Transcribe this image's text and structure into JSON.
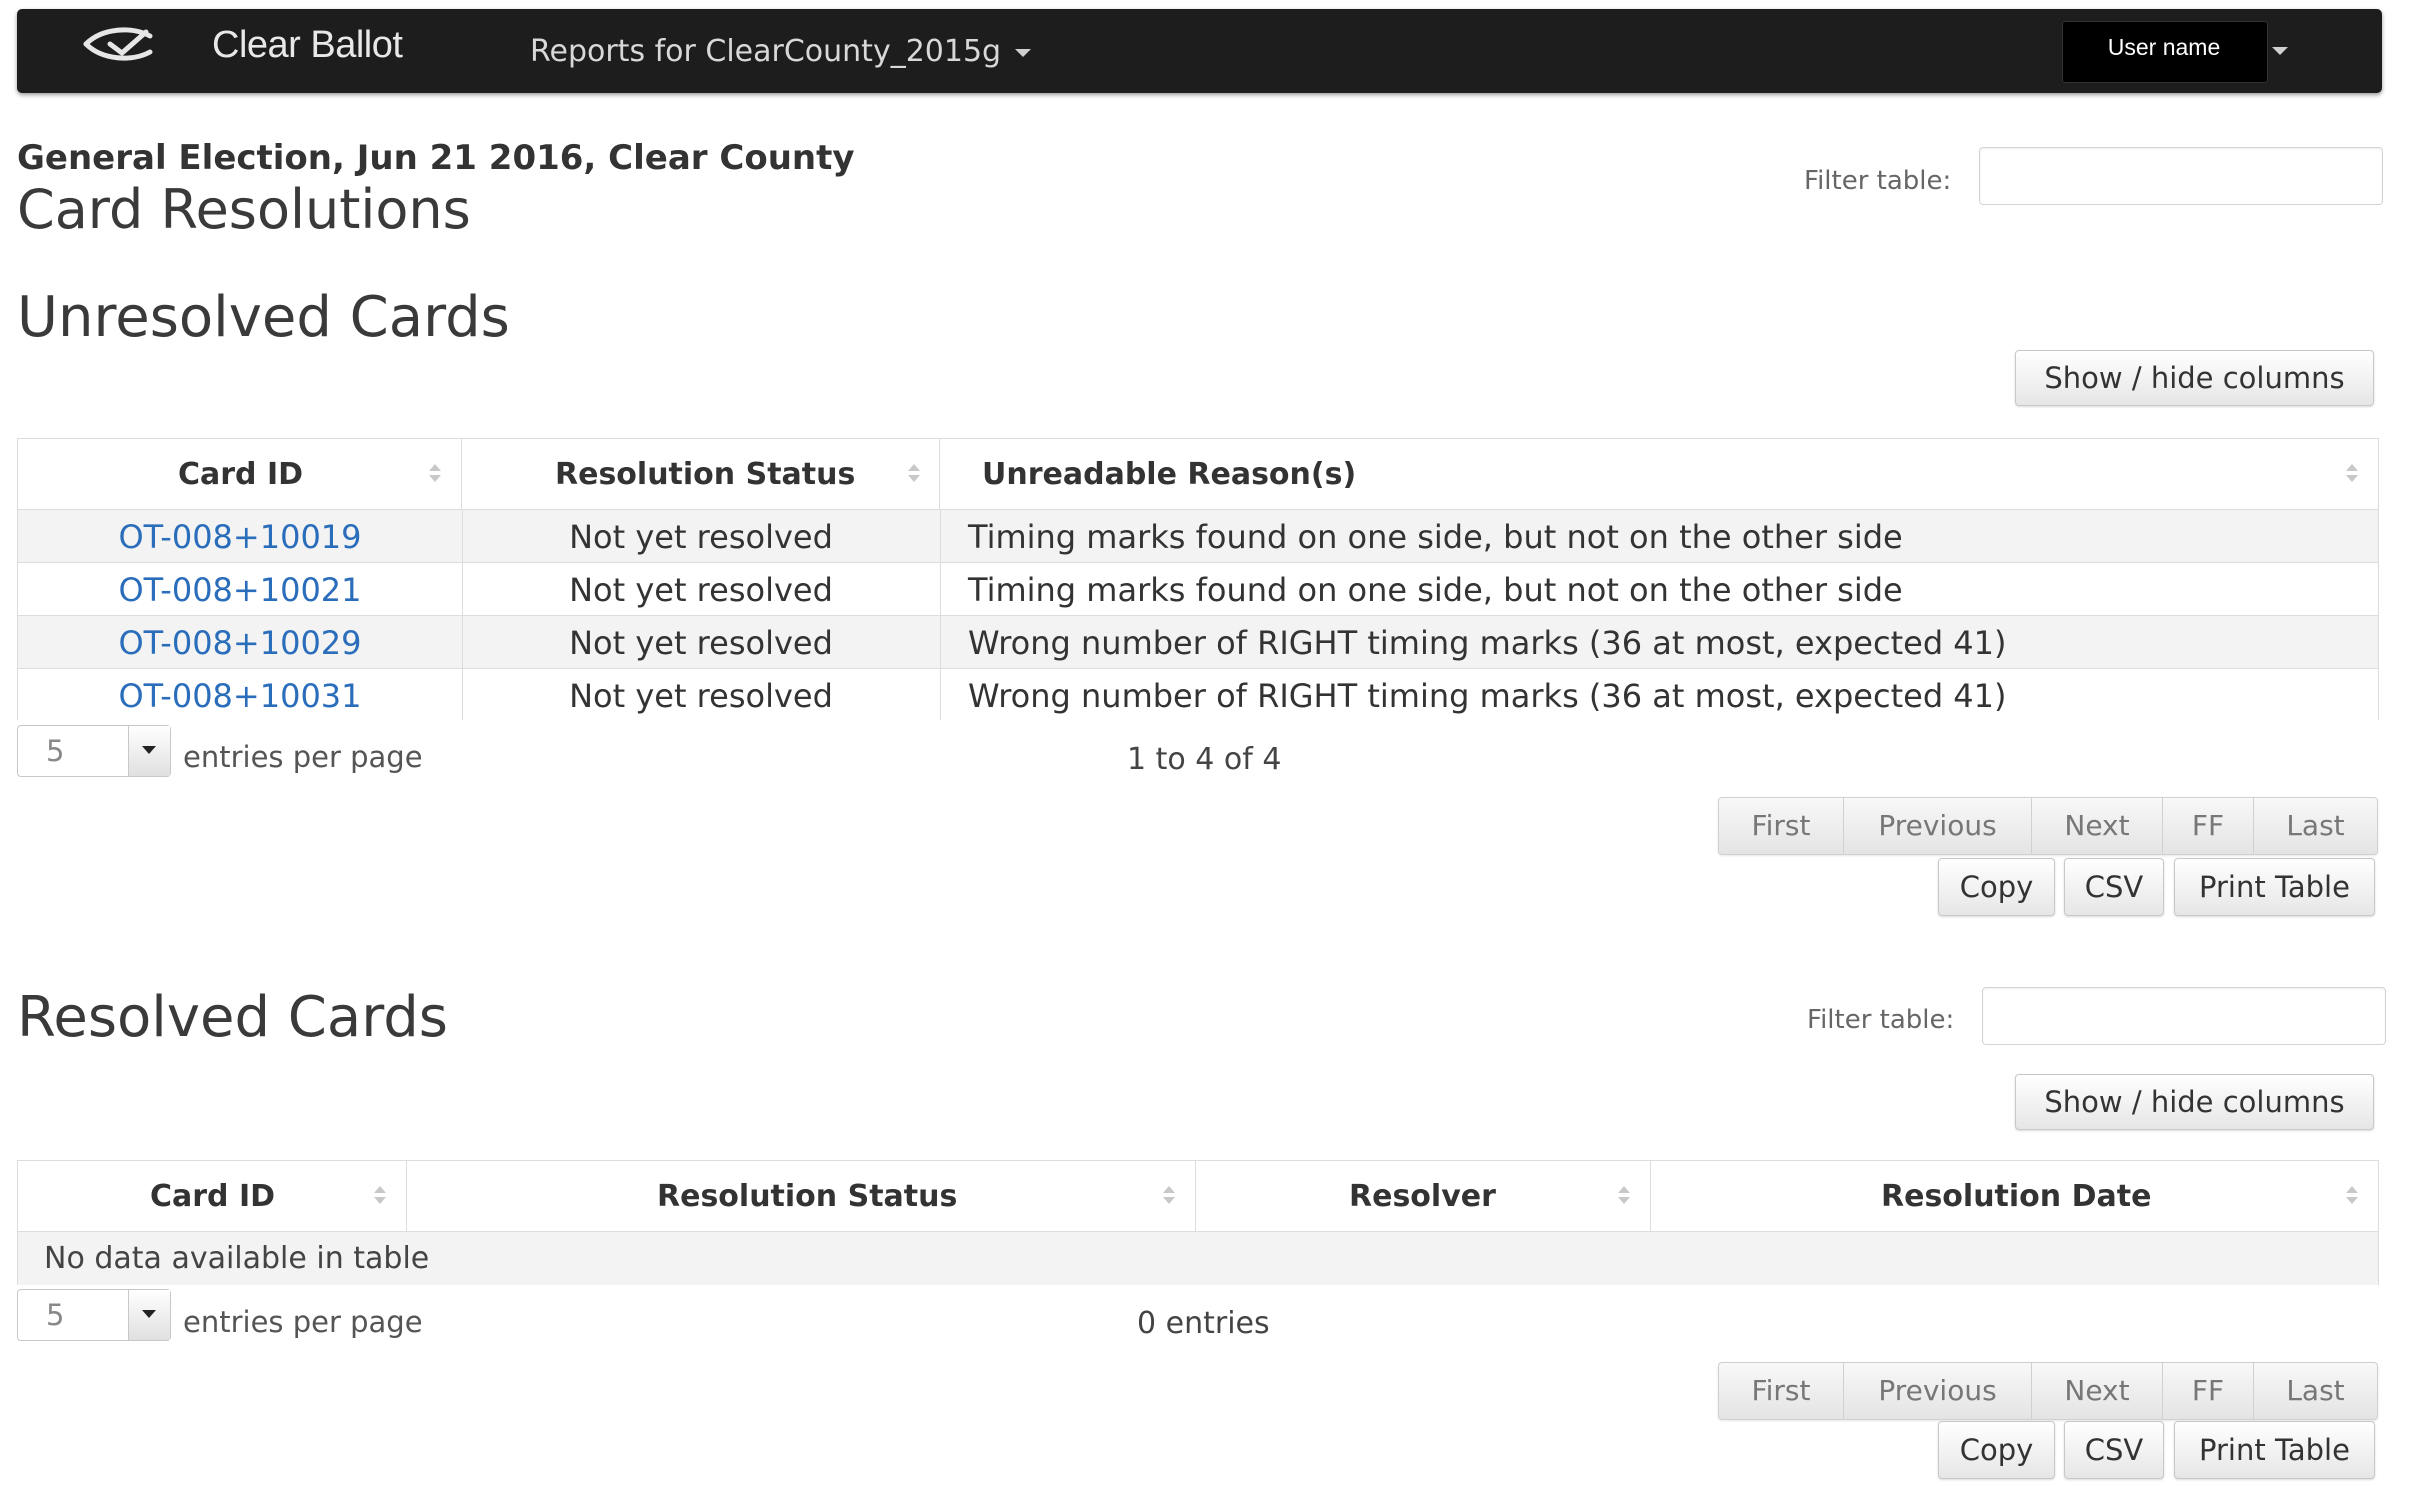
{
  "navbar": {
    "brand": "Clear Ballot",
    "reports_menu": "Reports for ClearCounty_2015g",
    "user_name": "User name"
  },
  "header": {
    "election": "General Election, Jun 21 2016, Clear County",
    "page_title": "Card Resolutions"
  },
  "unresolved": {
    "title": "Unresolved Cards",
    "filter_label": "Filter table:",
    "filter_value": "",
    "show_hide": "Show / hide columns",
    "columns": [
      "Card ID",
      "Resolution Status",
      "Unreadable Reason(s)"
    ],
    "rows": [
      [
        "OT-008+10019",
        "Not yet resolved",
        "Timing marks found on one side, but not on the other side"
      ],
      [
        "OT-008+10021",
        "Not yet resolved",
        "Timing marks found on one side, but not on the other side"
      ],
      [
        "OT-008+10029",
        "Not yet resolved",
        "Wrong number of RIGHT timing marks (36 at most, expected 41)"
      ],
      [
        "OT-008+10031",
        "Not yet resolved",
        "Wrong number of RIGHT timing marks (36 at most, expected 41)"
      ]
    ],
    "length_value": "5",
    "length_label": "entries per page",
    "info": "1 to 4 of 4"
  },
  "resolved": {
    "title": "Resolved Cards",
    "filter_label": "Filter table:",
    "filter_value": "",
    "show_hide": "Show / hide columns",
    "columns": [
      "Card ID",
      "Resolution Status",
      "Resolver",
      "Resolution Date"
    ],
    "empty": "No data available in table",
    "length_value": "5",
    "length_label": "entries per page",
    "info": "0 entries"
  },
  "pager": [
    "First",
    "Previous",
    "Next",
    "FF",
    "Last"
  ],
  "export": [
    "Copy",
    "CSV",
    "Print Table"
  ]
}
